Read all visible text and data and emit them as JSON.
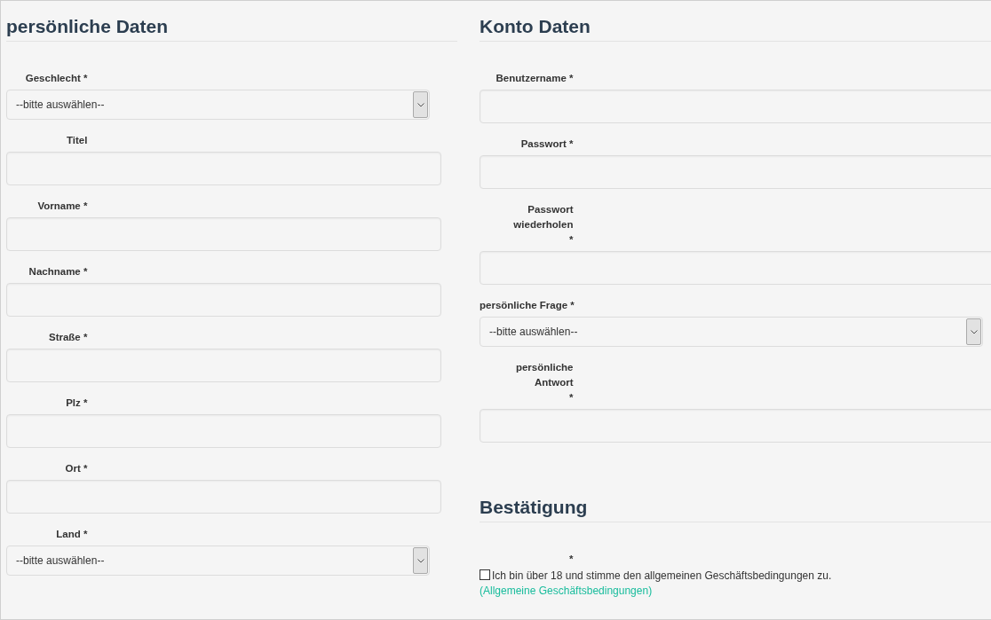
{
  "columns": [
    {
      "sections": [
        {
          "title": "persönliche Daten",
          "fields": [
            {
              "kind": "select",
              "label": [
                "Geschlecht *"
              ],
              "value": "--bitte auswählen--"
            },
            {
              "kind": "input",
              "label": [
                "Titel"
              ]
            },
            {
              "kind": "input",
              "label": [
                "Vorname *"
              ]
            },
            {
              "kind": "input",
              "label": [
                "Nachname *"
              ]
            },
            {
              "kind": "input",
              "label": [
                "Straße *"
              ]
            },
            {
              "kind": "input",
              "label": [
                "Plz *"
              ]
            },
            {
              "kind": "input",
              "label": [
                "Ort *"
              ]
            },
            {
              "kind": "select",
              "label": [
                "Land *"
              ],
              "value": "--bitte auswählen--"
            }
          ]
        }
      ]
    },
    {
      "sections": [
        {
          "title": "Konto Daten",
          "fields": [
            {
              "kind": "input",
              "label": [
                "Benutzername *"
              ]
            },
            {
              "kind": "input",
              "label": [
                "Passwort *"
              ]
            },
            {
              "kind": "input",
              "label": [
                "Passwort",
                "wiederholen",
                "*"
              ]
            },
            {
              "kind": "select",
              "label": [
                "persönliche Frage *"
              ],
              "value": "--bitte auswählen--"
            },
            {
              "kind": "input",
              "label": [
                "persönliche",
                "Antwort",
                "*"
              ]
            }
          ]
        },
        {
          "title": "Bestätigung",
          "fields": [
            {
              "kind": "checkbox",
              "label": [
                "*"
              ],
              "checked": false,
              "text": "Ich bin über 18 und stimme den allgemeinen Geschäftsbedingungen zu.",
              "link": "(Allgemeine Geschäftsbedingungen)"
            }
          ]
        }
      ]
    }
  ]
}
